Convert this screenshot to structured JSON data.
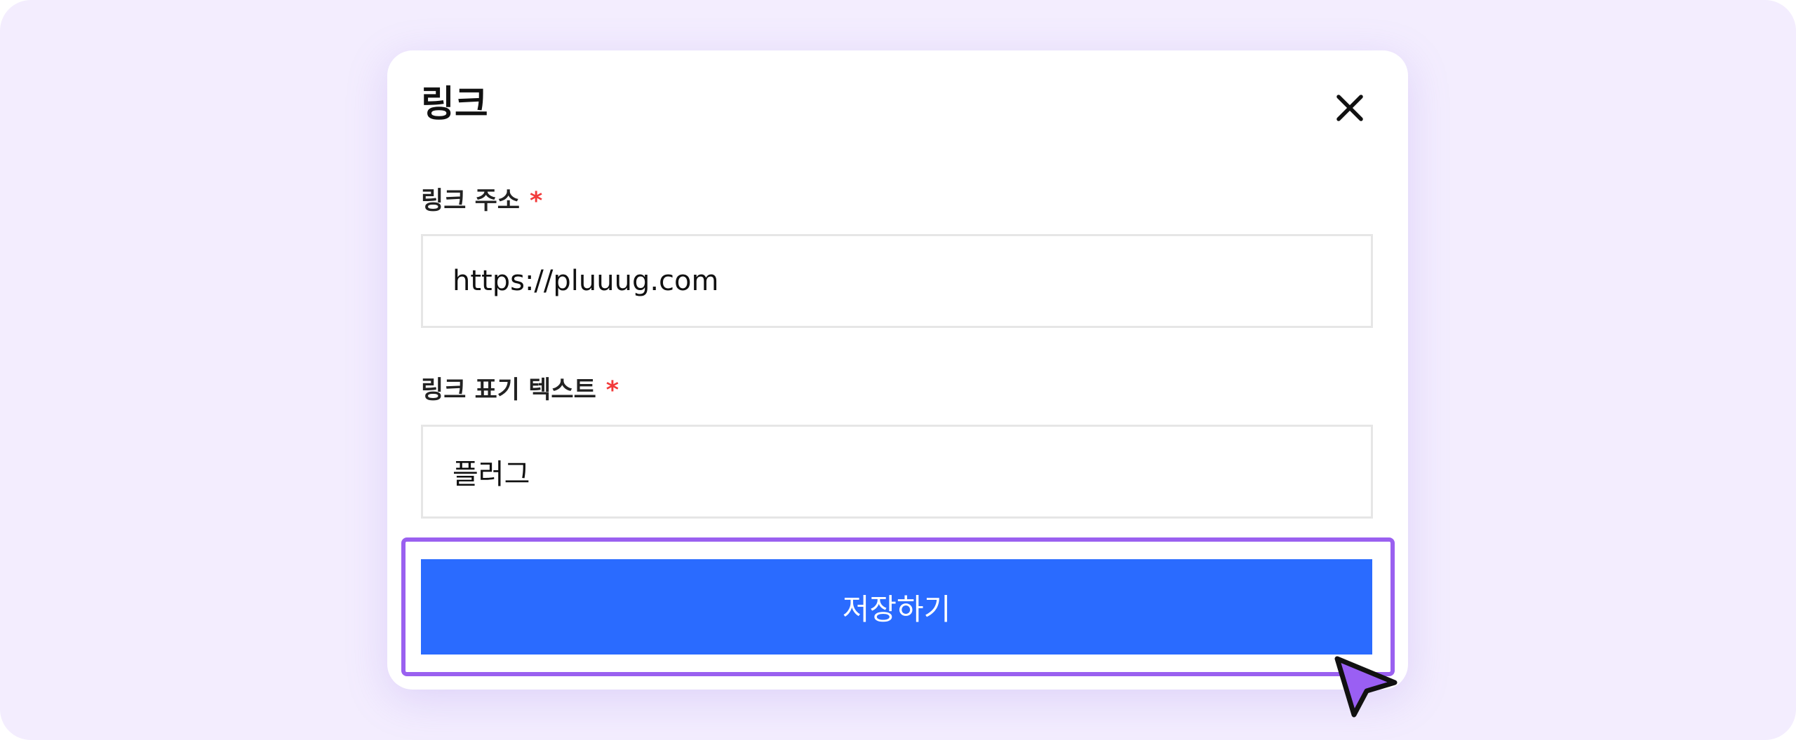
{
  "dialog": {
    "title": "링크",
    "close_icon": "close-icon"
  },
  "fields": {
    "url": {
      "label": "링크 주소",
      "required_mark": "*",
      "value": "https://pluuug.com"
    },
    "display_text": {
      "label": "링크 표기 텍스트",
      "required_mark": "*",
      "value": "플러그"
    }
  },
  "actions": {
    "save_label": "저장하기"
  },
  "colors": {
    "background": "#f3edfe",
    "accent": "#2a6bff",
    "highlight": "#9a60f0",
    "required": "#f23a3a"
  },
  "pointer_icon": "cursor-arrow-icon"
}
